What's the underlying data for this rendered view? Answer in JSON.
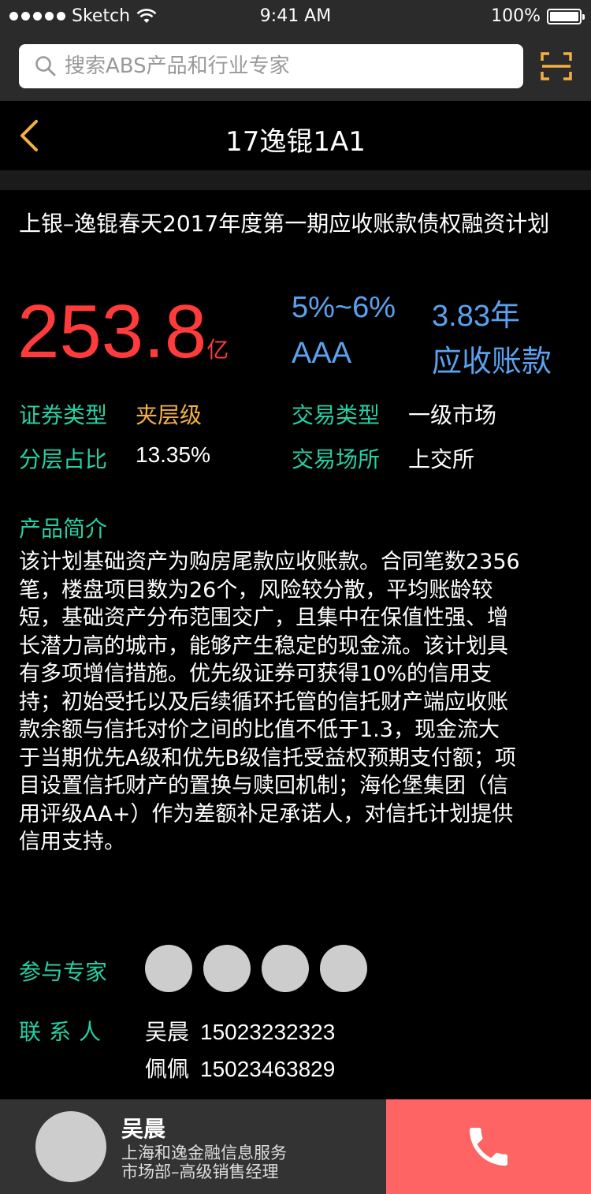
{
  "status_bar": {
    "carrier": "Sketch",
    "time": "9:41 AM",
    "battery": "100%"
  },
  "search": {
    "placeholder": "搜索ABS产品和行业专家"
  },
  "nav": {
    "title": "17逸锟1A1"
  },
  "product": {
    "full_title": "上银–逸锟春天2017年度第一期应收账款债权融资计划",
    "amount": "253.8",
    "amount_unit": "亿",
    "yield_range": "5%~6%",
    "term": "3.83年",
    "rating": "AAA",
    "asset_type": "应收账款"
  },
  "info": {
    "security_type_label": "证券类型",
    "security_type_value": "夹层级",
    "trade_type_label": "交易类型",
    "trade_type_value": "一级市场",
    "tranche_ratio_label": "分层占比",
    "tranche_ratio_value": "13.35%",
    "venue_label": "交易场所",
    "venue_value": "上交所"
  },
  "intro": {
    "heading": "产品简介",
    "lines": [
      "该计划基础资产为购房尾款应收账款。合同笔数2356",
      "笔，楼盘项目数为26个，风险较分散，平均账龄较",
      "短，基础资产分布范围交广，且集中在保值性强、增",
      "长潜力高的城市，能够产生稳定的现金流。该计划具",
      "有多项增信措施。优先级证券可获得10%的信用支",
      "持；初始受托以及后续循环托管的信托财产端应收账",
      "款余额与信托对价之间的比值不低于1.3，现金流大",
      "于当期优先A级和优先B级信托受益权预期支付额；项",
      "目设置信托财产的置换与赎回机制；海伦堡集团（信",
      "用评级AA+）作为差额补足承诺人，对信托计划提供",
      "信用支持。"
    ]
  },
  "experts": {
    "label": "参与专家"
  },
  "contacts": {
    "label": "联系人",
    "items": [
      {
        "name": "吴晨",
        "phone": "15023232323"
      },
      {
        "name": "佩佩",
        "phone": "15023463829"
      }
    ]
  },
  "footer": {
    "name": "吴晨",
    "company": "上海和逸金融信息服务",
    "title": "市场部–高级销售经理"
  },
  "colors": {
    "accent_red": "#ff3b3b",
    "metric_blue": "#5aa2f0",
    "label_teal": "#26d0a5",
    "highlight_orange": "#f5b042",
    "call_button": "#ff6464"
  },
  "icons": [
    "signal-dots-icon",
    "wifi-icon",
    "battery-icon",
    "search-icon",
    "scan-icon",
    "back-chevron-icon",
    "phone-icon"
  ]
}
